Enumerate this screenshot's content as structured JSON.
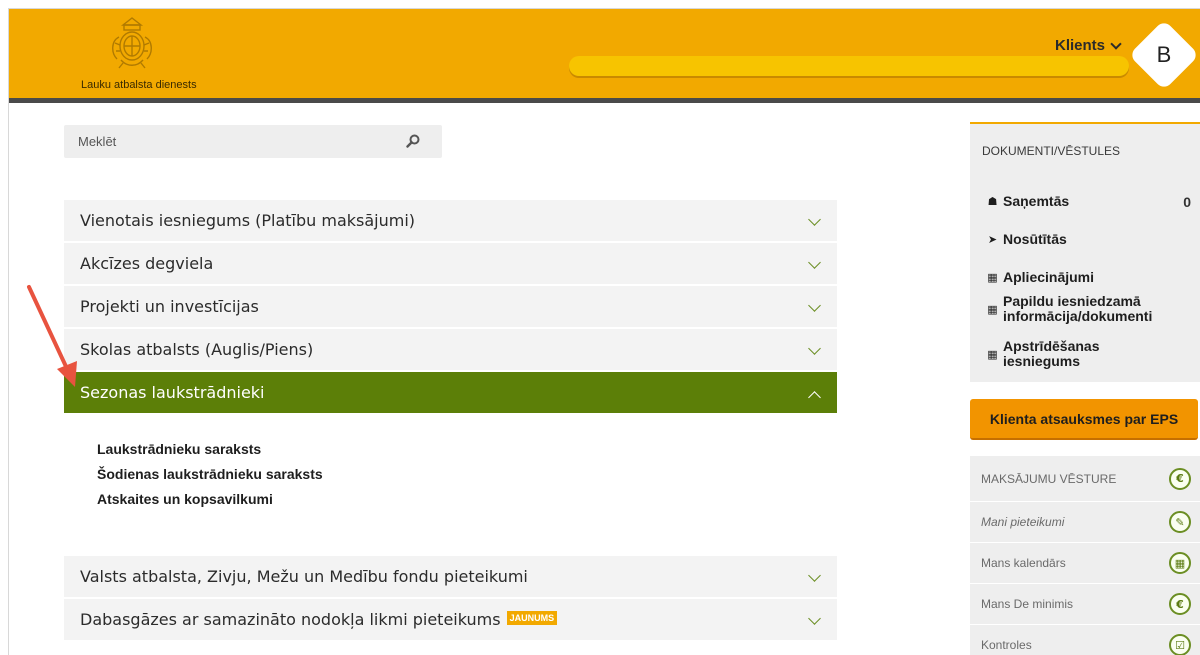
{
  "header": {
    "logo_text": "Lauku atbalsta dienests",
    "client_label": "Klients",
    "avatar_letter": "B"
  },
  "search": {
    "placeholder": "Meklēt"
  },
  "accordion": {
    "items": [
      {
        "label": "Vienotais iesniegums (Platību maksājumi)"
      },
      {
        "label": "Akcīzes degviela"
      },
      {
        "label": "Projekti un investīcijas"
      },
      {
        "label": "Skolas atbalsts (Auglis/Piens)"
      },
      {
        "label": "Sezonas laukstrādnieki",
        "expanded": true,
        "sub_items": [
          {
            "label": "Laukstrādnieku saraksts"
          },
          {
            "label": "Šodienas laukstrādnieku saraksts"
          },
          {
            "label": "Atskaites un kopsavilkumi"
          }
        ]
      },
      {
        "label": "Valsts atbalsta, Zivju, Mežu un Medību fondu pieteikumi"
      },
      {
        "label": "Dabasgāzes ar samazināto nodokļa likmi pieteikums",
        "badge": "JAUNUMS"
      }
    ]
  },
  "sidebar": {
    "docs_title": "DOKUMENTI/VĒSTULES",
    "docs": [
      {
        "label": "Saņemtās",
        "icon": "inbox-icon",
        "count": "0"
      },
      {
        "label": "Nosūtītās",
        "icon": "send-icon"
      },
      {
        "label": "Apliecinājumi",
        "icon": "document-icon"
      },
      {
        "label_line1": "Papildu iesniedzamā",
        "label_line2": "informācija/dokumenti",
        "icon": "document-icon"
      },
      {
        "label_line1": "Apstrīdēšanas",
        "label_line2": "iesniegums",
        "icon": "document-icon"
      }
    ],
    "feedback_button": "Klienta atsauksmes par EPS",
    "nav": [
      {
        "label": "MAKSĀJUMU VĒSTURE",
        "icon": "euro-icon"
      },
      {
        "label": "Mani pieteikumi",
        "icon": "edit-document-icon"
      },
      {
        "label": "Mans kalendārs",
        "icon": "calendar-icon"
      },
      {
        "label": "Mans De minimis",
        "icon": "euro-icon"
      },
      {
        "label": "Kontroles",
        "icon": "checklist-icon"
      }
    ]
  },
  "colors": {
    "header": "#f2a900",
    "active_item": "#5c7f08",
    "feedback_button": "#f29400",
    "badge": "#f2a900"
  }
}
